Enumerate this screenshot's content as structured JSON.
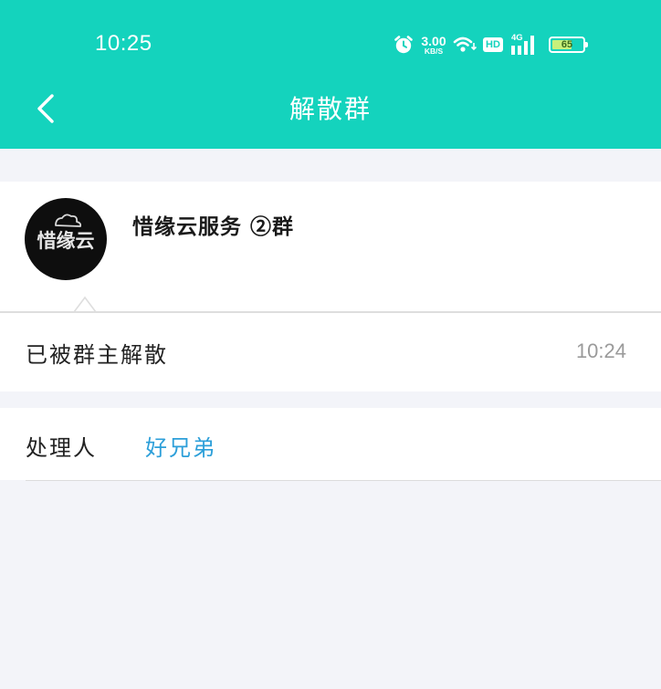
{
  "status_bar": {
    "time": "10:25",
    "net_speed_value": "3.00",
    "net_speed_unit": "KB/S",
    "hd_label": "HD",
    "network_type": "4G",
    "battery_level": "65",
    "battery_fraction": 0.65,
    "icons": [
      "alarm-icon",
      "wifi-icon",
      "signal-icon",
      "battery-icon"
    ]
  },
  "nav": {
    "back_icon": "chevron-left-icon",
    "title": "解散群"
  },
  "group": {
    "name": "惜缘云服务 ②群",
    "avatar_text": "惜缘云",
    "avatar_icon": "cloud-icon"
  },
  "notice": {
    "message": "已被群主解散",
    "time": "10:24"
  },
  "handler": {
    "label": "处理人",
    "name": "好兄弟"
  },
  "colors": {
    "header": "#14d3bd",
    "background": "#f3f4f9",
    "link": "#2d9fd9",
    "battery_fill": "#c8f07a"
  }
}
